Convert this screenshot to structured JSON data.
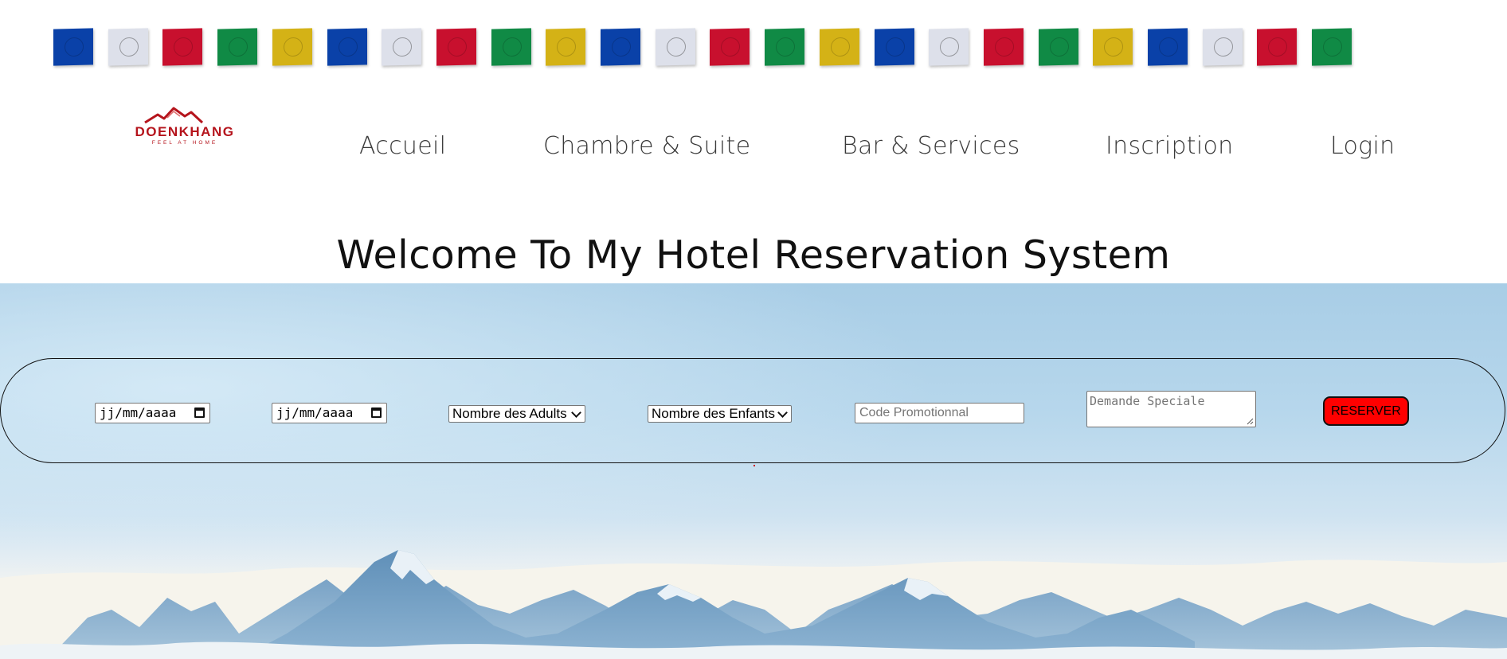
{
  "flags": [
    "blue",
    "white",
    "red",
    "green",
    "yellow",
    "blue",
    "white",
    "red",
    "green",
    "yellow",
    "blue",
    "white",
    "red",
    "green",
    "yellow",
    "blue",
    "white",
    "red",
    "green",
    "yellow",
    "blue",
    "white",
    "red",
    "green"
  ],
  "colors": {
    "blue": "#0a41a8",
    "white": "#dde0ea",
    "red": "#c8102e",
    "green": "#108a45",
    "yellow": "#d4b216",
    "brand": "#b5141c",
    "button": "#ff0000"
  },
  "logo": {
    "name": "DOENKHANG",
    "tagline": "FEEL AT HOME"
  },
  "nav": [
    {
      "label": "Accueil"
    },
    {
      "label": "Chambre & Suite"
    },
    {
      "label": "Bar & Services"
    },
    {
      "label": "Inscription"
    },
    {
      "label": "Login"
    }
  ],
  "title": "Welcome To My Hotel Reservation System",
  "booking": {
    "checkin_placeholder": "jj/mm/aaaa",
    "checkout_placeholder": "jj/mm/aaaa",
    "adults_label": "Nombre des Adults",
    "children_label": "Nombre des Enfants",
    "promo_placeholder": "Code Promotionnal",
    "request_placeholder": "Demande Speciale",
    "submit_label": "RESERVER"
  }
}
